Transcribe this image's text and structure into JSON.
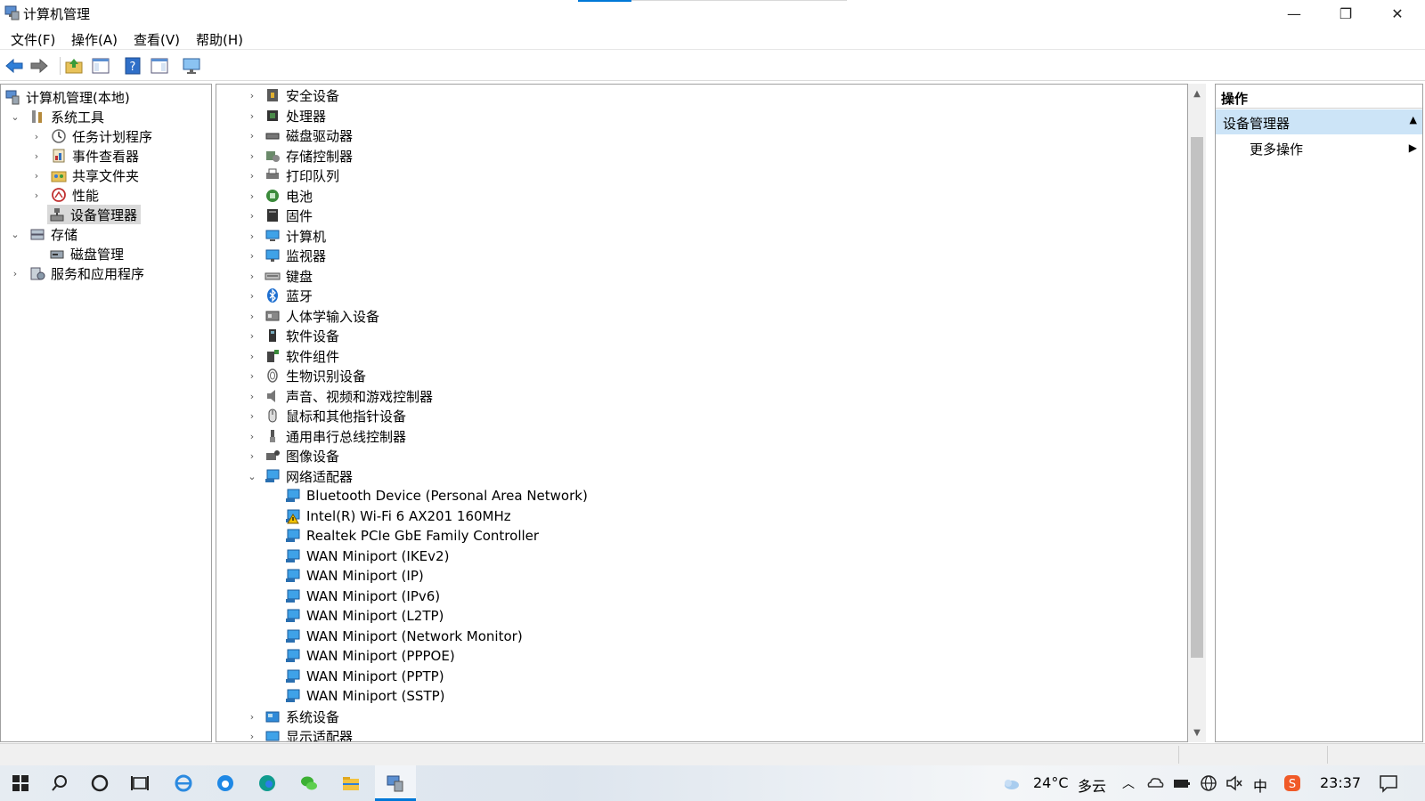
{
  "window": {
    "title": "计算机管理",
    "controls": {
      "minimize": "—",
      "restore": "❐",
      "close": "✕"
    }
  },
  "menu": [
    "文件(F)",
    "操作(A)",
    "查看(V)",
    "帮助(H)"
  ],
  "toolbar_icons": [
    "back-arrow-icon",
    "forward-arrow-icon",
    "up-folder-icon",
    "show-hide-console-tree-icon",
    "help-icon",
    "action-pane-icon",
    "monitor-icon"
  ],
  "tree": {
    "root": "计算机管理(本地)",
    "system_tools": "系统工具",
    "task_scheduler": "任务计划程序",
    "event_viewer": "事件查看器",
    "shared_folders": "共享文件夹",
    "performance": "性能",
    "device_manager": "设备管理器",
    "storage": "存储",
    "disk_management": "磁盘管理",
    "services_apps": "服务和应用程序"
  },
  "devices": {
    "categories_before": [
      {
        "label": "安全设备",
        "icon": "security-device-icon"
      },
      {
        "label": "处理器",
        "icon": "processor-icon"
      },
      {
        "label": "磁盘驱动器",
        "icon": "disk-drive-icon"
      },
      {
        "label": "存储控制器",
        "icon": "storage-controller-icon"
      },
      {
        "label": "打印队列",
        "icon": "printer-icon"
      },
      {
        "label": "电池",
        "icon": "battery-icon"
      },
      {
        "label": "固件",
        "icon": "firmware-icon"
      },
      {
        "label": "计算机",
        "icon": "computer-icon"
      },
      {
        "label": "监视器",
        "icon": "monitor-icon"
      },
      {
        "label": "键盘",
        "icon": "keyboard-icon"
      },
      {
        "label": "蓝牙",
        "icon": "bluetooth-icon"
      },
      {
        "label": "人体学输入设备",
        "icon": "hid-icon"
      },
      {
        "label": "软件设备",
        "icon": "software-device-icon"
      },
      {
        "label": "软件组件",
        "icon": "software-component-icon"
      },
      {
        "label": "生物识别设备",
        "icon": "biometric-icon"
      },
      {
        "label": "声音、视频和游戏控制器",
        "icon": "speaker-icon"
      },
      {
        "label": "鼠标和其他指针设备",
        "icon": "mouse-icon"
      },
      {
        "label": "通用串行总线控制器",
        "icon": "usb-icon"
      },
      {
        "label": "图像设备",
        "icon": "camera-icon"
      }
    ],
    "network_adapters": {
      "label": "网络适配器",
      "items": [
        {
          "label": "Bluetooth Device (Personal Area Network)",
          "warning": false
        },
        {
          "label": "Intel(R) Wi-Fi 6 AX201 160MHz",
          "warning": true
        },
        {
          "label": "Realtek PCIe GbE Family Controller",
          "warning": false
        },
        {
          "label": "WAN Miniport (IKEv2)",
          "warning": false
        },
        {
          "label": "WAN Miniport (IP)",
          "warning": false
        },
        {
          "label": "WAN Miniport (IPv6)",
          "warning": false
        },
        {
          "label": "WAN Miniport (L2TP)",
          "warning": false
        },
        {
          "label": "WAN Miniport (Network Monitor)",
          "warning": false
        },
        {
          "label": "WAN Miniport (PPPOE)",
          "warning": false
        },
        {
          "label": "WAN Miniport (PPTP)",
          "warning": false
        },
        {
          "label": "WAN Miniport (SSTP)",
          "warning": false
        }
      ]
    },
    "categories_after": [
      {
        "label": "系统设备",
        "icon": "system-device-icon"
      },
      {
        "label": "显示适配器",
        "icon": "display-adapter-icon"
      }
    ]
  },
  "actions": {
    "header": "操作",
    "selected": "设备管理器",
    "more": "更多操作"
  },
  "taskbar": {
    "weather_temp": "24°C",
    "weather_desc": "多云",
    "ime": "中",
    "clock": "23:37"
  },
  "colors": {
    "accent": "#0078d7",
    "selection": "#cce4f7"
  }
}
